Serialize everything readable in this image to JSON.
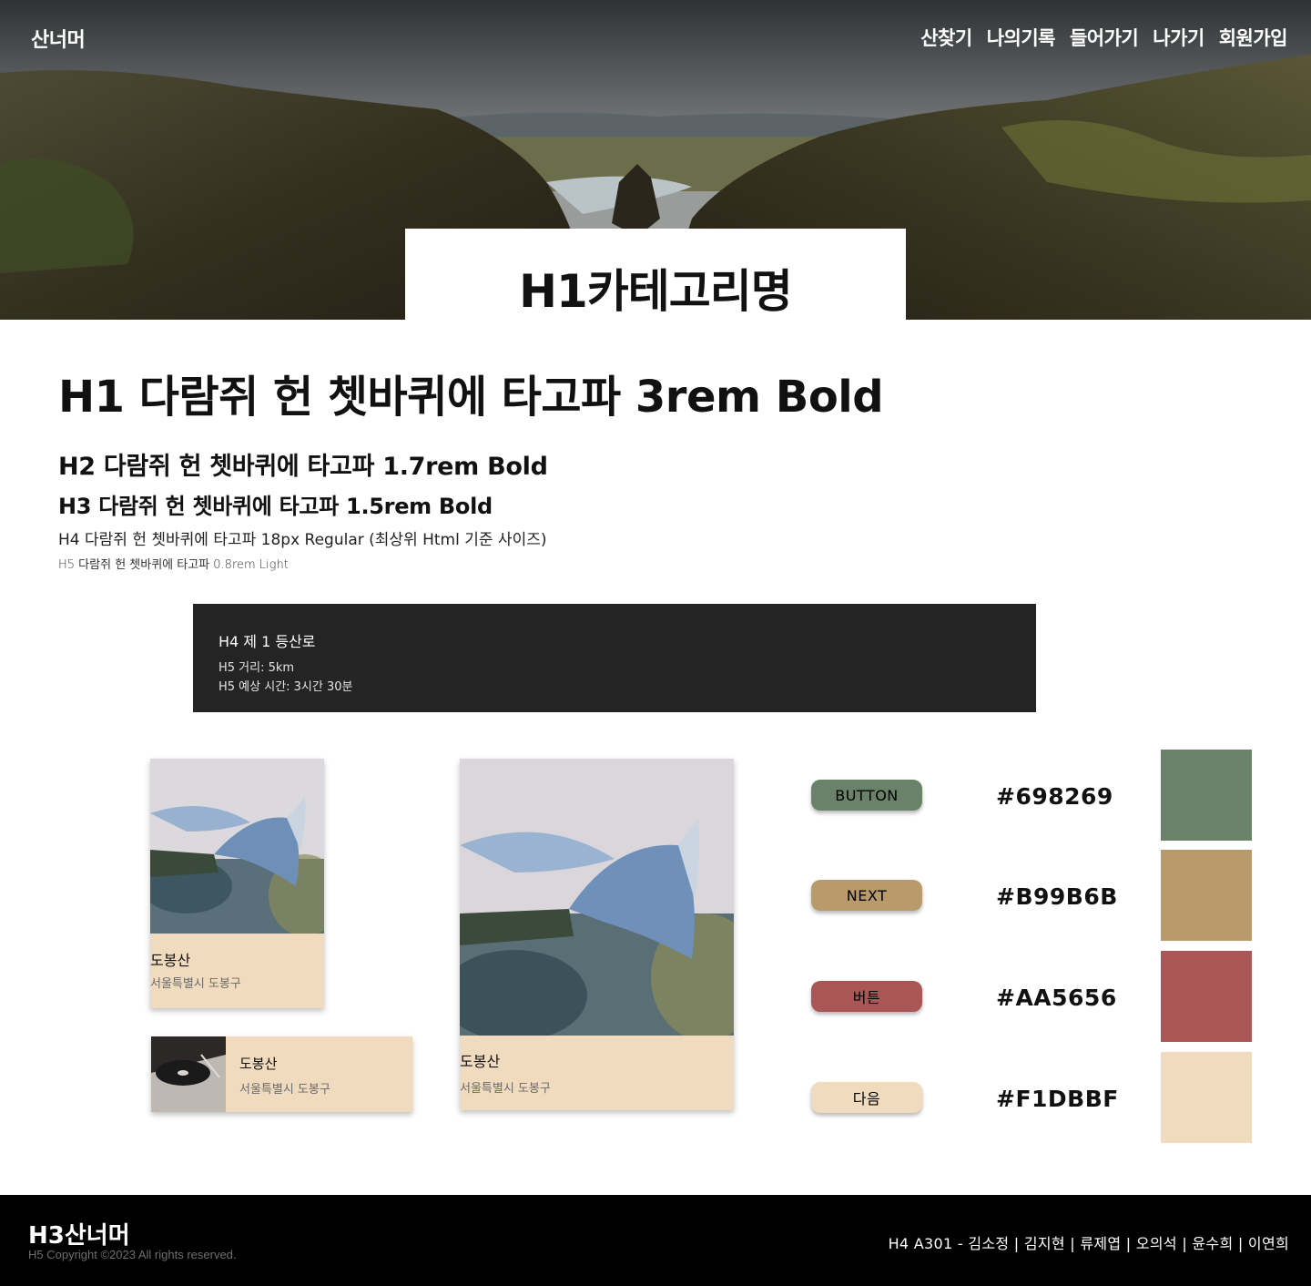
{
  "header": {
    "logo": "산너머",
    "nav": [
      "산찾기",
      "나의기록",
      "들어가기",
      "나가기",
      "회원가입"
    ],
    "category_title": "H1카테고리명"
  },
  "typography": {
    "h1": "H1 다람쥐 헌 쳇바퀴에 타고파 3rem Bold",
    "h2": "H2 다람쥐 헌 쳇바퀴에 타고파 1.7rem Bold",
    "h3": "H3 다람쥐 헌 쳇바퀴에 타고파 1.5rem Bold",
    "h4": "H4 다람쥐 헌 쳇바퀴에 타고파 18px Regular (최상위 Html 기준 사이즈)",
    "h5": "H5 다람쥐 헌 쳇바퀴에 타고파 0.8rem Light"
  },
  "route": {
    "title": "H4 제 1 등산로",
    "distance": "H5 거리: 5km",
    "time": "H5 예상 시간: 3시간 30분"
  },
  "cards": [
    {
      "name": "도봉산",
      "address": "서울특별시 도봉구"
    },
    {
      "name": "도봉산",
      "address": "서울특별시 도봉구"
    },
    {
      "name": "도봉산",
      "address": "서울특별시 도봉구"
    }
  ],
  "buttons": [
    {
      "label": "BUTTON",
      "bg": "#698269",
      "color": "#111111"
    },
    {
      "label": "NEXT",
      "bg": "#B99B6B",
      "color": "#111111"
    },
    {
      "label": "버튼",
      "bg": "#AA5656",
      "color": "#111111"
    },
    {
      "label": "다음",
      "bg": "#F1DBBF",
      "color": "#111111"
    }
  ],
  "palette": [
    {
      "hex": "#698269"
    },
    {
      "hex": "#B99B6B"
    },
    {
      "hex": "#AA5656"
    },
    {
      "hex": "#F1DBBF"
    }
  ],
  "footer": {
    "logo": "H3산너머",
    "copyright": "H5 Copyright ©2023 All rights reserved.",
    "team": "H4 A301 - 김소정 | 김지현 | 류제엽 | 오의석 | 윤수희 | 이연희"
  }
}
